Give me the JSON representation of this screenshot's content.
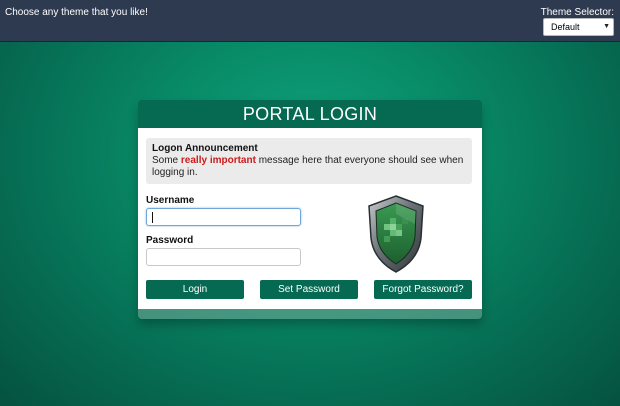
{
  "topbar": {
    "message": "Choose any theme that you like!",
    "theme_label": "Theme Selector:",
    "theme_value": "Default"
  },
  "panel": {
    "title": "PORTAL LOGIN",
    "announcement": {
      "title": "Logon Announcement",
      "msg_before": "Some ",
      "msg_highlight": "really important",
      "msg_after": " message here that everyone should see when logging in."
    },
    "username_label": "Username",
    "username_value": "",
    "password_label": "Password",
    "password_value": "",
    "buttons": {
      "login": "Login",
      "set_password": "Set Password",
      "forgot_password": "Forgot Password?"
    },
    "emblem_icon": "shield-icon"
  },
  "colors": {
    "topbar_bg": "#2d3a4f",
    "accent": "#066a53",
    "background": "#088a67",
    "highlight": "#cc1b1b"
  }
}
